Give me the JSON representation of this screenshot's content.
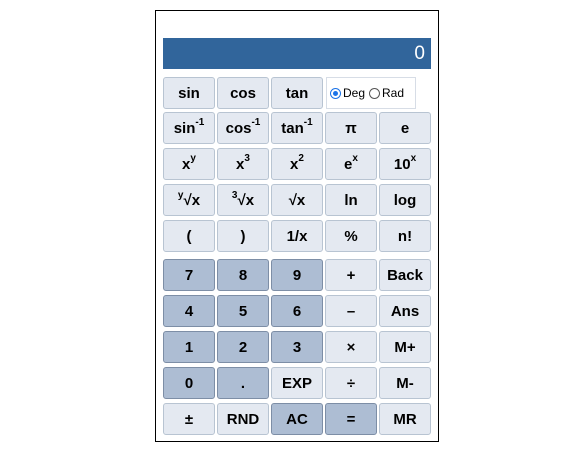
{
  "display": {
    "value": "0"
  },
  "angle": {
    "deg_label": "Deg",
    "rad_label": "Rad",
    "selected": "Deg"
  },
  "buttons": {
    "sin": "sin",
    "cos": "cos",
    "tan": "tan",
    "asin_base": "sin",
    "acos_base": "cos",
    "atan_base": "tan",
    "inverse_sup": "-1",
    "pi": "π",
    "e": "e",
    "xy_base": "x",
    "xy_sup": "y",
    "x3_base": "x",
    "x3_sup": "3",
    "x2_base": "x",
    "x2_sup": "2",
    "ex_base": "e",
    "ex_sup": "x",
    "tenx_base": "10",
    "tenx_sup": "x",
    "yroot_pre": "y",
    "yroot_main": "√x",
    "cbrt_pre": "3",
    "cbrt_main": "√x",
    "sqrt": "√x",
    "ln": "ln",
    "log": "log",
    "lparen": "(",
    "rparen": ")",
    "recip": "1/x",
    "percent": "%",
    "fact": "n!",
    "d7": "7",
    "d8": "8",
    "d9": "9",
    "plus": "+",
    "back": "Back",
    "d4": "4",
    "d5": "5",
    "d6": "6",
    "minus": "–",
    "ans": "Ans",
    "d1": "1",
    "d2": "2",
    "d3": "3",
    "times": "×",
    "mplus": "M+",
    "d0": "0",
    "dot": ".",
    "exp": "EXP",
    "divide": "÷",
    "mminus": "M-",
    "plusminus": "±",
    "rnd": "RND",
    "ac": "AC",
    "equals": "=",
    "mr": "MR"
  }
}
